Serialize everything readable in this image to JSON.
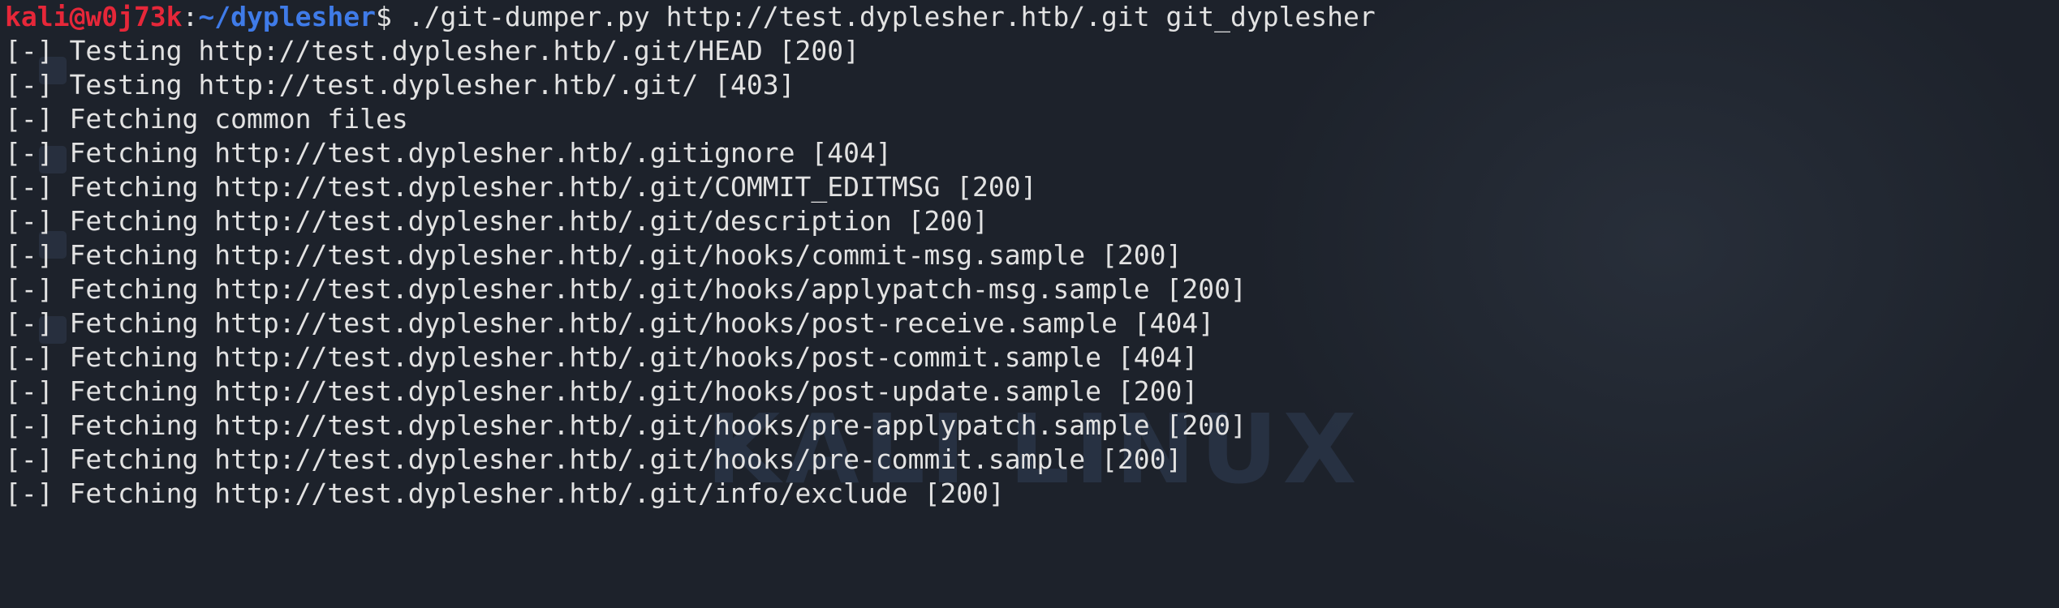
{
  "terminal": {
    "prompt": {
      "user_host": "kali@w0j73k",
      "separator": ":",
      "path": "~/dyplesher",
      "sign": "$",
      "command": " ./git-dumper.py http://test.dyplesher.htb/.git git_dyplesher"
    },
    "output_lines": [
      "[-] Testing http://test.dyplesher.htb/.git/HEAD [200]",
      "[-] Testing http://test.dyplesher.htb/.git/ [403]",
      "[-] Fetching common files",
      "[-] Fetching http://test.dyplesher.htb/.gitignore [404]",
      "[-] Fetching http://test.dyplesher.htb/.git/COMMIT_EDITMSG [200]",
      "[-] Fetching http://test.dyplesher.htb/.git/description [200]",
      "[-] Fetching http://test.dyplesher.htb/.git/hooks/commit-msg.sample [200]",
      "[-] Fetching http://test.dyplesher.htb/.git/hooks/applypatch-msg.sample [200]",
      "[-] Fetching http://test.dyplesher.htb/.git/hooks/post-receive.sample [404]",
      "[-] Fetching http://test.dyplesher.htb/.git/hooks/post-commit.sample [404]",
      "[-] Fetching http://test.dyplesher.htb/.git/hooks/post-update.sample [200]",
      "[-] Fetching http://test.dyplesher.htb/.git/hooks/pre-applypatch.sample [200]",
      "[-] Fetching http://test.dyplesher.htb/.git/hooks/pre-commit.sample [200]",
      "[-] Fetching http://test.dyplesher.htb/.git/info/exclude [200]"
    ]
  },
  "background": {
    "watermark_text": "KALI LINUX"
  },
  "colors": {
    "background": "#1d222b",
    "text": "#e2e2e2",
    "prompt_user": "#e62739",
    "prompt_path": "#3f7be8"
  }
}
